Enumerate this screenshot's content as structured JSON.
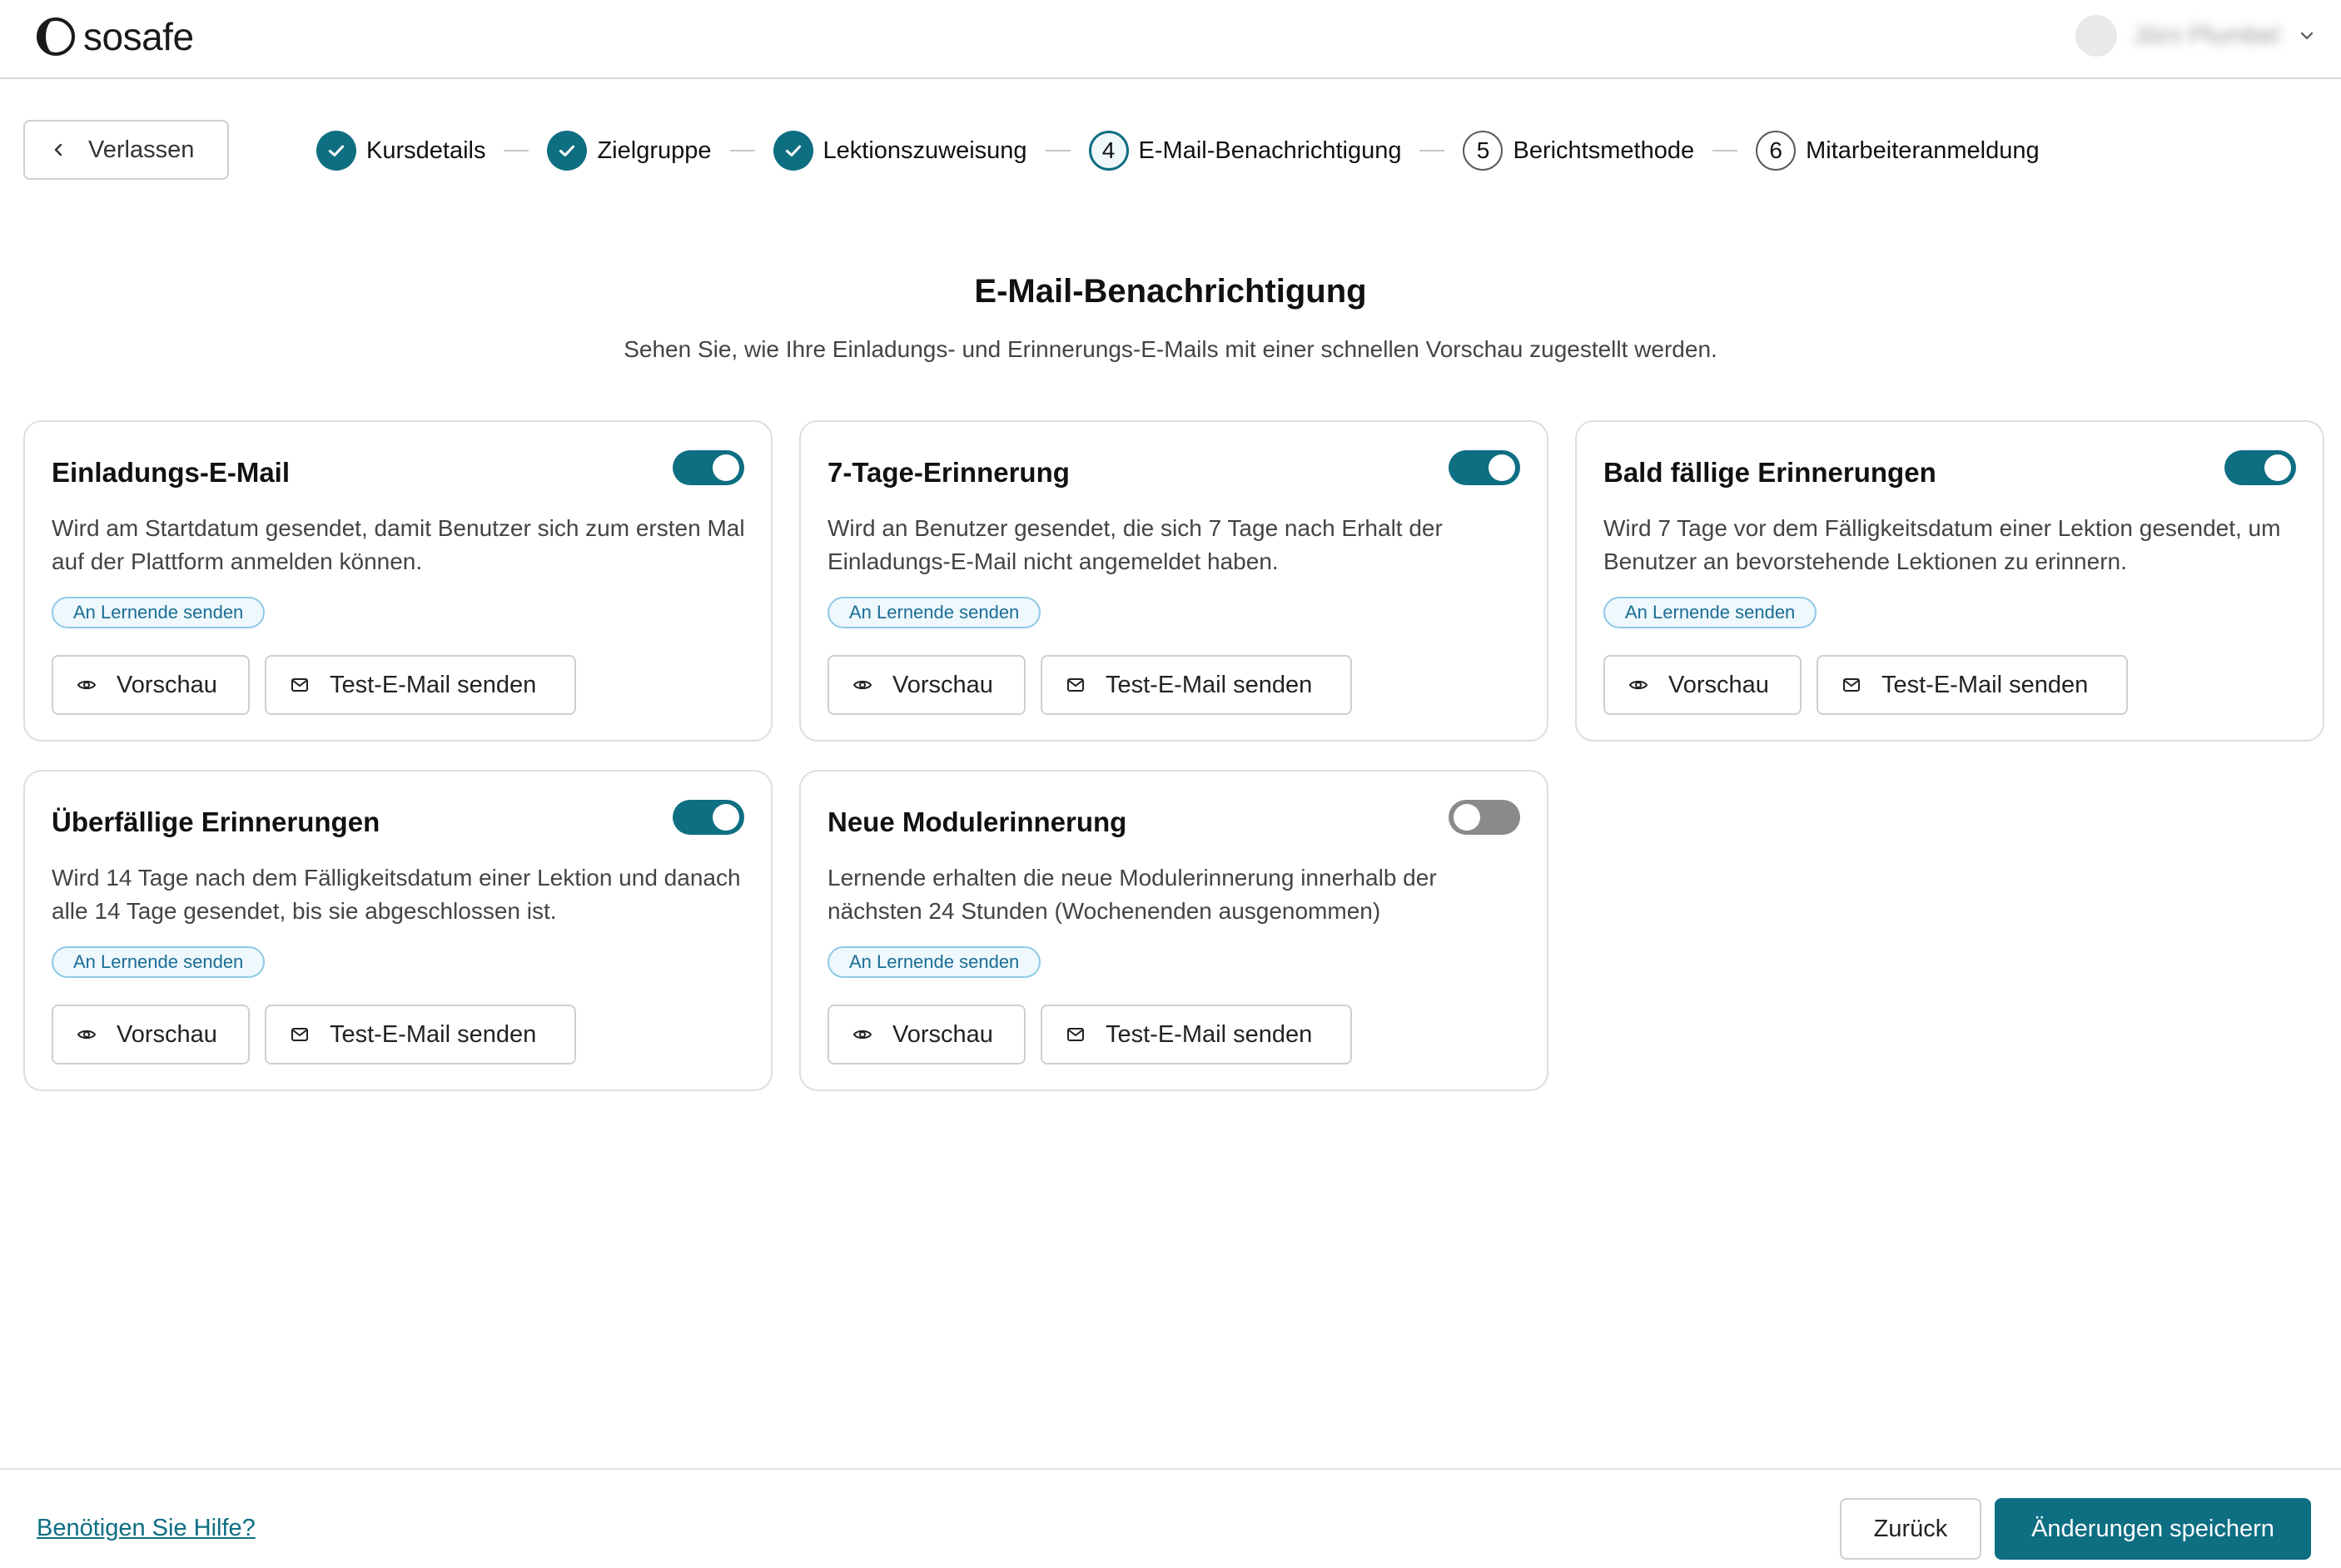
{
  "header": {
    "logo_text": "sosafe",
    "user_name": "Jörn Plumbel"
  },
  "stepper": {
    "exit_label": "Verlassen",
    "steps": [
      {
        "label": "Kursdetails",
        "state": "done"
      },
      {
        "label": "Zielgruppe",
        "state": "done"
      },
      {
        "label": "Lektionszuweisung",
        "state": "done"
      },
      {
        "number": "4",
        "label": "E-Mail-Benachrichtigung",
        "state": "current"
      },
      {
        "number": "5",
        "label": "Berichtsmethode",
        "state": "todo"
      },
      {
        "number": "6",
        "label": "Mitarbeiteranmeldung",
        "state": "todo"
      }
    ]
  },
  "page": {
    "title": "E-Mail-Benachrichtigung",
    "subtitle": "Sehen Sie, wie Ihre Einladungs- und Erinnerungs-E-Mails mit einer schnellen Vorschau zugestellt werden."
  },
  "cards": [
    {
      "title": "Einladungs-E-Mail",
      "enabled": true,
      "description": "Wird am Startdatum gesendet, damit Benutzer sich zum ersten Mal auf der Plattform anmelden können.",
      "badge": "An Lernende senden",
      "preview_label": "Vorschau",
      "test_label": "Test-E-Mail senden"
    },
    {
      "title": "7-Tage-Erinnerung",
      "enabled": true,
      "description": "Wird an Benutzer gesendet, die sich 7 Tage nach Erhalt der Einladungs-E-Mail nicht angemeldet haben.",
      "badge": "An Lernende senden",
      "preview_label": "Vorschau",
      "test_label": "Test-E-Mail senden"
    },
    {
      "title": "Bald fällige Erinnerungen",
      "enabled": true,
      "description": "Wird 7 Tage vor dem Fälligkeitsdatum einer Lektion gesendet, um Benutzer an bevorstehende Lektionen zu erinnern.",
      "badge": "An Lernende senden",
      "preview_label": "Vorschau",
      "test_label": "Test-E-Mail senden"
    },
    {
      "title": "Überfällige Erinnerungen",
      "enabled": true,
      "description": "Wird 14 Tage nach dem Fälligkeitsdatum einer Lektion und danach alle 14 Tage gesendet, bis sie abgeschlossen ist.",
      "badge": "An Lernende senden",
      "preview_label": "Vorschau",
      "test_label": "Test-E-Mail senden"
    },
    {
      "title": "Neue Modulerinnerung",
      "enabled": false,
      "description": "Lernende erhalten die neue Modulerinnerung innerhalb der nächsten 24 Stunden (Wochenenden ausgenommen)",
      "badge": "An Lernende senden",
      "preview_label": "Vorschau",
      "test_label": "Test-E-Mail senden"
    }
  ],
  "footer": {
    "help_label": "Benötigen Sie Hilfe?",
    "back_label": "Zurück",
    "save_label": "Änderungen speichern"
  },
  "colors": {
    "accent": "#0e6e82",
    "badge_bg": "#eef8fd",
    "badge_border": "#8fc9e6",
    "toggle_off": "#8a8a8a"
  }
}
